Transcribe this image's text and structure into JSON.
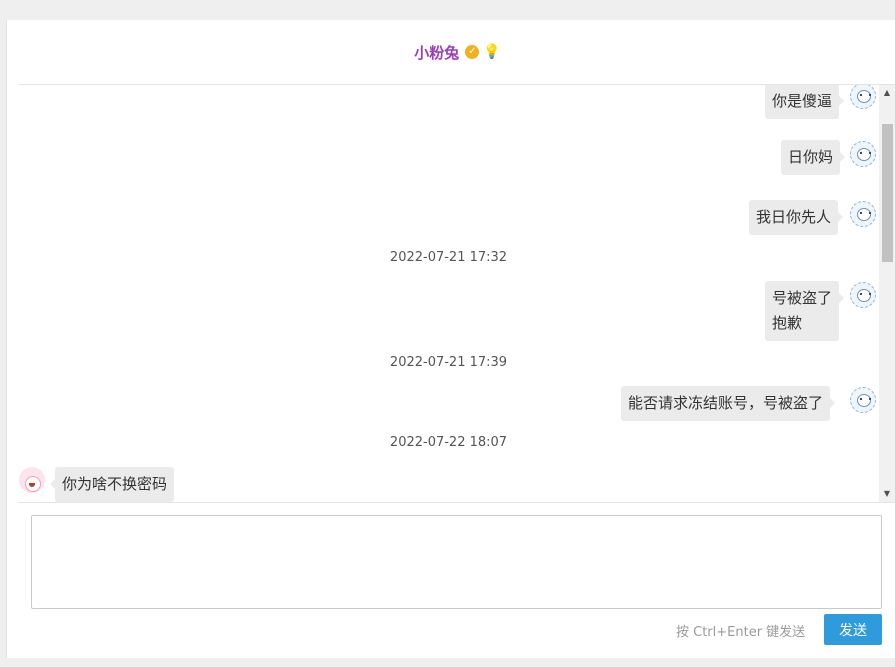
{
  "header": {
    "title": "小粉兔",
    "verified_icon": "verified-badge-icon",
    "bulb_icon": "lightbulb-icon",
    "verified_color": "#f2b01e",
    "bulb_color": "#f5c518"
  },
  "messages": [
    {
      "side": "right",
      "text": "你是傻逼",
      "avatar": "robot-avatar"
    },
    {
      "side": "right",
      "text": "日你妈",
      "avatar": "robot-avatar"
    },
    {
      "side": "right",
      "text": "我日你先人",
      "avatar": "robot-avatar"
    },
    {
      "timestamp": "2022-07-21 17:32"
    },
    {
      "side": "right",
      "lines": [
        "号被盗了",
        "抱歉"
      ],
      "avatar": "robot-avatar"
    },
    {
      "timestamp": "2022-07-21 17:39"
    },
    {
      "side": "right",
      "text": "能否请求冻结账号，号被盗了",
      "avatar": "robot-avatar"
    },
    {
      "timestamp": "2022-07-22 18:07"
    },
    {
      "side": "left",
      "text": "你为啥不换密码",
      "avatar": "bunny-avatar"
    }
  ],
  "composer": {
    "value": "",
    "hint": "按 Ctrl+Enter 键发送",
    "send_label": "发送",
    "send_color": "#2e9bdc"
  },
  "scrollbar": {
    "up_icon": "scroll-up-arrow-icon",
    "down_icon": "scroll-down-arrow-icon",
    "up_glyph": "▲",
    "down_glyph": "▼"
  }
}
